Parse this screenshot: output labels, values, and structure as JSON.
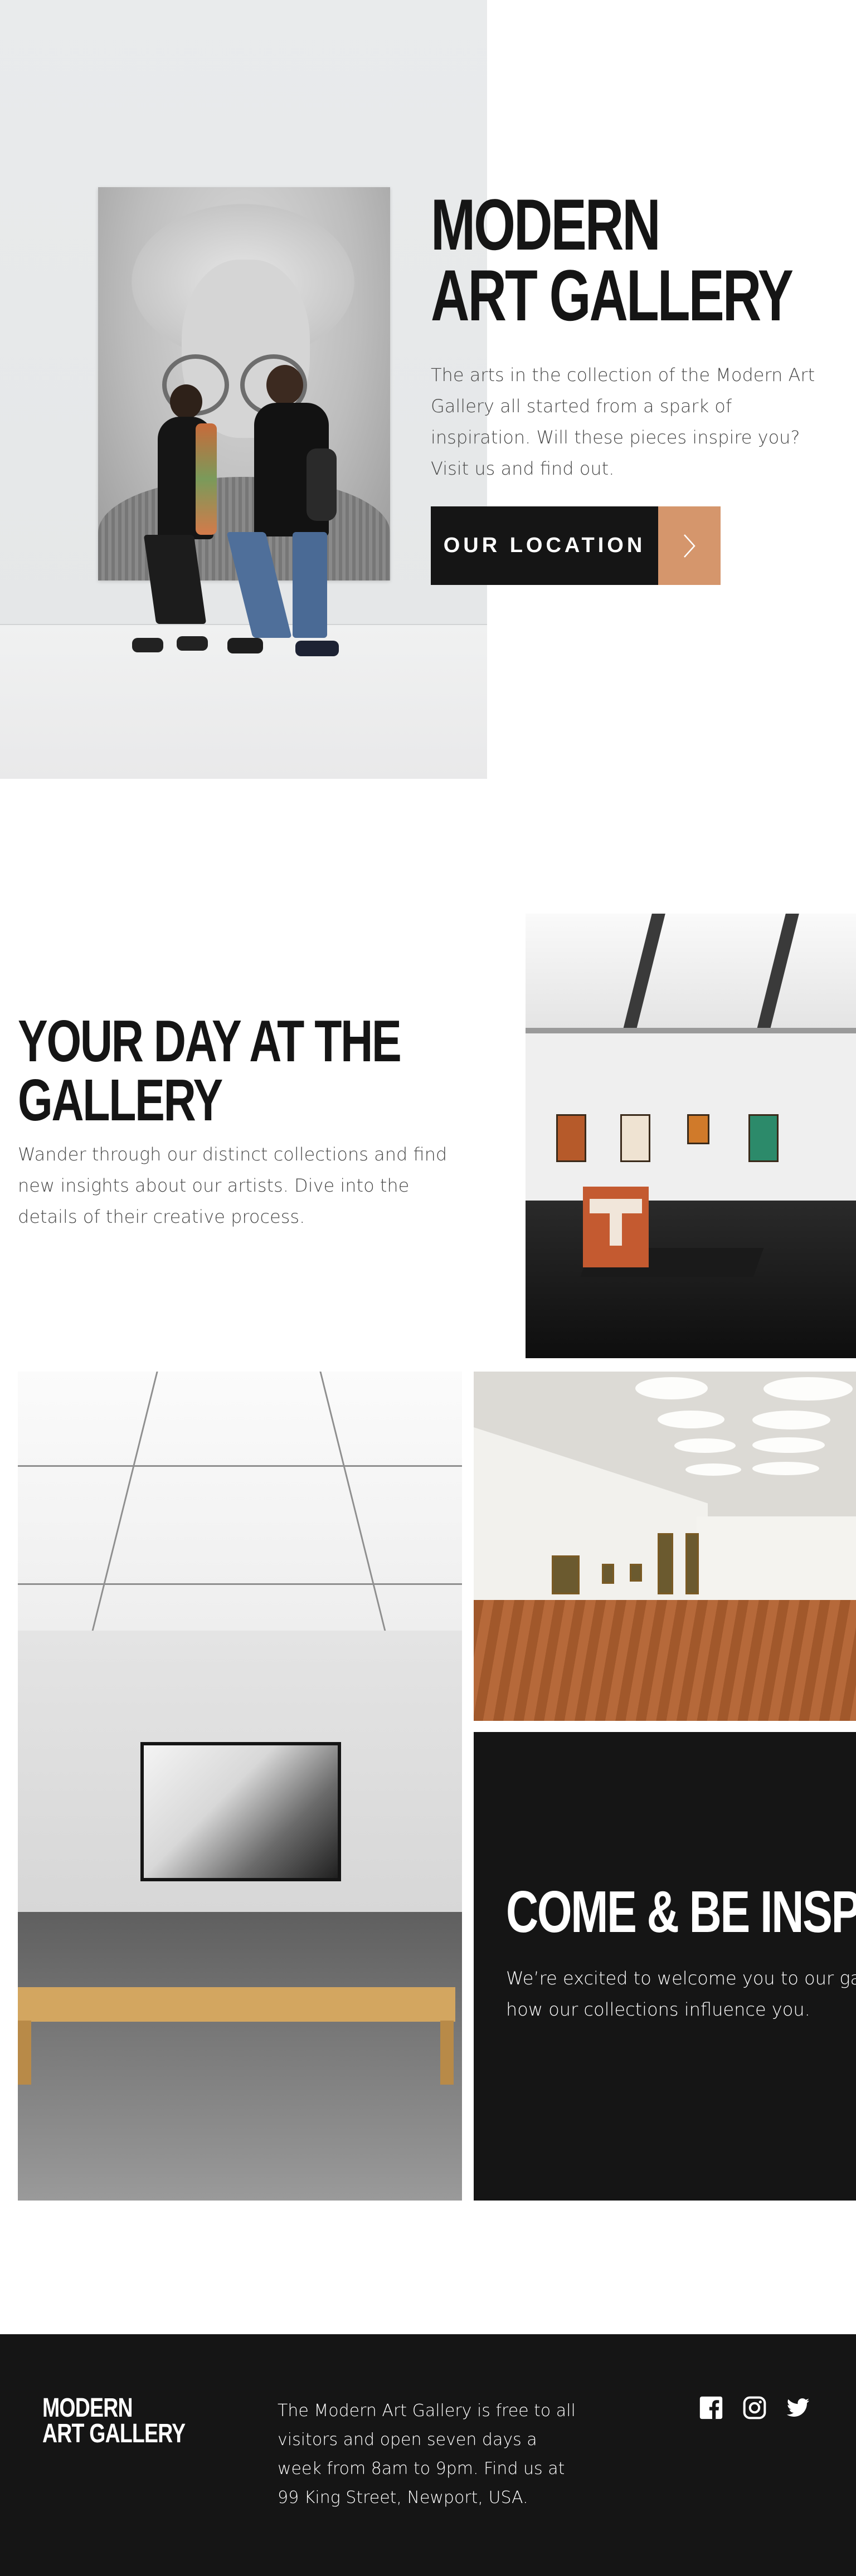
{
  "hero": {
    "title_line1": "MODERN",
    "title_line2": "ART GALLERY",
    "description": "The arts in the collection of the Modern Art Gallery all started from a spark of inspiration. Will these pieces inspire you? Visit us and find out.",
    "button_label": "OUR LOCATION",
    "button_icon": "chevron-right-icon"
  },
  "day": {
    "title_line1": "YOUR DAY AT THE",
    "title_line2": "GALLERY",
    "description": "Wander through our distinct collections and find new insights about our artists. Dive into the details of their creative process."
  },
  "inspire": {
    "title": "COME & BE INSPIRED",
    "description": "We’re excited to welcome you to our gallery and see how our collections influence you."
  },
  "footer": {
    "logo_line1": "MODERN",
    "logo_line2": "ART GALLERY",
    "description": "The Modern Art Gallery is free to all visitors and open seven days a week from 8am to 9pm. Find us at 99 King Street, Newport, USA.",
    "social_icons": [
      "facebook-icon",
      "instagram-icon",
      "twitter-icon"
    ]
  },
  "colors": {
    "dark": "#151515",
    "accent": "#d5966c",
    "text_gray": "#4a4a4a",
    "white": "#ffffff"
  }
}
